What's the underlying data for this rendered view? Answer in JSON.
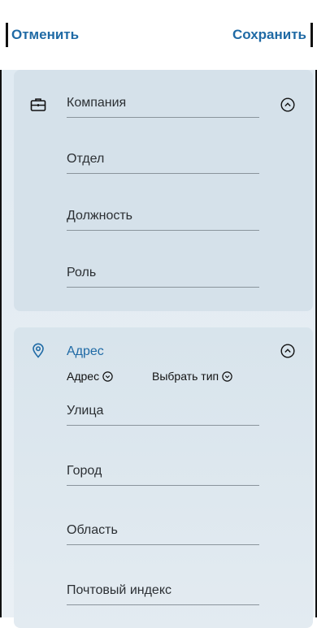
{
  "header": {
    "cancel_label": "Отменить",
    "save_label": "Сохранить"
  },
  "company_section": {
    "icon": "briefcase-icon",
    "fields": [
      {
        "placeholder": "Компания"
      },
      {
        "placeholder": "Отдел"
      },
      {
        "placeholder": "Должность"
      },
      {
        "placeholder": "Роль"
      }
    ]
  },
  "address_section": {
    "icon": "location-pin-icon",
    "title": "Адрес",
    "type_selector": {
      "address_label": "Адрес",
      "choose_type_label": "Выбрать тип"
    },
    "fields": [
      {
        "placeholder": "Улица"
      },
      {
        "placeholder": "Город"
      },
      {
        "placeholder": "Область"
      },
      {
        "placeholder": "Почтовый индекс"
      }
    ]
  },
  "colors": {
    "accent": "#1f6aa5",
    "card_bg": "#d5e1ea",
    "divider": "#8a949c"
  }
}
